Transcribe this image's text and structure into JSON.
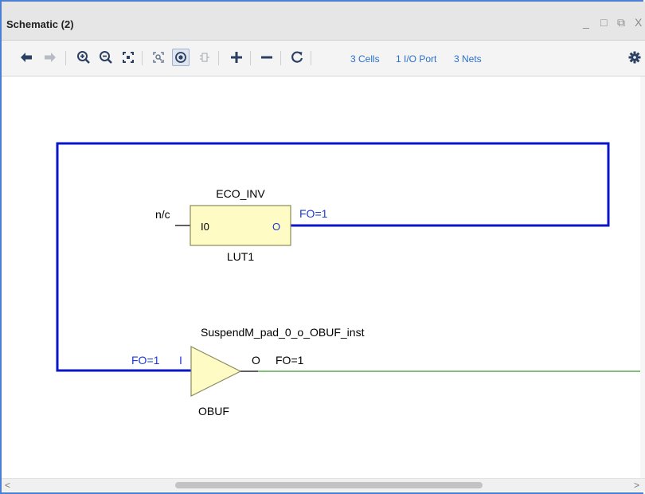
{
  "window": {
    "title": "Schematic (2)",
    "controls": {
      "minimize": "_",
      "maximize": "□",
      "restore": "⧉",
      "close": "X"
    }
  },
  "toolbar": {
    "icons": [
      "back-arrow-icon",
      "forward-arrow-icon",
      "zoom-in-icon",
      "zoom-out-icon",
      "zoom-fit-icon",
      "zoom-area-icon",
      "select-mode-icon",
      "expand-icon",
      "add-icon",
      "remove-icon",
      "refresh-icon",
      "gear-icon"
    ],
    "cells_link": "3 Cells",
    "ports_link": "1 I/O Port",
    "nets_link": "3 Nets"
  },
  "schematic": {
    "lut": {
      "instance_name": "ECO_INV",
      "cell_type": "LUT1",
      "input_pin": "I0",
      "output_pin": "O",
      "unconnected_label": "n/c",
      "fanout_label": "FO=1"
    },
    "obuf": {
      "instance_name": "SuspendM_pad_0_o_OBUF_inst",
      "cell_type": "OBUF",
      "input_pin": "I",
      "output_pin": "O",
      "input_fanout_label": "FO=1",
      "output_fanout_label": "FO=1"
    },
    "colors": {
      "net": "#0a16c8",
      "output_net": "#3a9a2a",
      "cell_fill": "#fffbc4",
      "cell_border": "#8a8a5a",
      "pin_text": "#1a3ad8"
    }
  },
  "scrollbar": {
    "left_arrow": "<",
    "right_arrow": ">"
  }
}
